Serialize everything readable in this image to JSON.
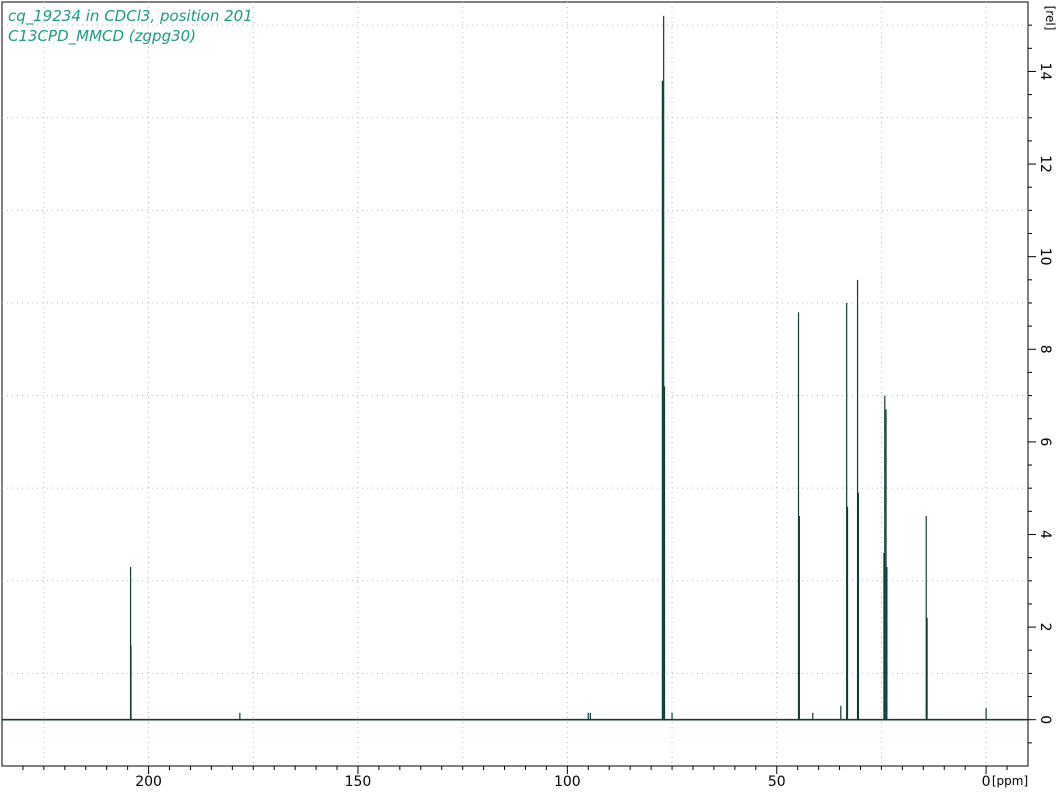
{
  "title_lines": [
    "cq_19234 in CDCl3, position 201",
    "C13CPD_MMCD (zgpg30)"
  ],
  "colors": {
    "spectrum": "#0d3b38",
    "title": "#1b9a86",
    "grid": "#b8b8b8",
    "frame": "#000000"
  },
  "chart_data": {
    "type": "line",
    "title": "cq_19234 in CDCl3, position 201",
    "subtitle": "C13CPD_MMCD (zgpg30)",
    "xlabel": "[ppm]",
    "ylabel": "[rel]",
    "xlim": [
      235,
      -10
    ],
    "ylim": [
      -1,
      15.5
    ],
    "x_reversed": true,
    "grid": true,
    "x_ticks": [
      200,
      150,
      100,
      50,
      0
    ],
    "x_tick_labels": [
      "200",
      "150",
      "100",
      "50",
      "0"
    ],
    "y_ticks": [
      0,
      2,
      4,
      6,
      8,
      10,
      12,
      14
    ],
    "y_tick_labels": [
      "0",
      "2",
      "4",
      "6",
      "8",
      "10",
      "12",
      "14"
    ],
    "peaks": [
      {
        "ppm": 204.3,
        "intensity": 3.3
      },
      {
        "ppm": 204.2,
        "intensity": 1.6
      },
      {
        "ppm": 178.2,
        "intensity": 0.15
      },
      {
        "ppm": 95.0,
        "intensity": 0.15
      },
      {
        "ppm": 94.5,
        "intensity": 0.15
      },
      {
        "ppm": 77.3,
        "intensity": 13.8
      },
      {
        "ppm": 77.0,
        "intensity": 15.2
      },
      {
        "ppm": 76.8,
        "intensity": 7.2
      },
      {
        "ppm": 75.0,
        "intensity": 0.15
      },
      {
        "ppm": 44.8,
        "intensity": 8.8
      },
      {
        "ppm": 44.6,
        "intensity": 4.4
      },
      {
        "ppm": 41.4,
        "intensity": 0.15
      },
      {
        "ppm": 34.7,
        "intensity": 0.3
      },
      {
        "ppm": 33.3,
        "intensity": 9.0
      },
      {
        "ppm": 33.1,
        "intensity": 4.6
      },
      {
        "ppm": 30.7,
        "intensity": 9.5
      },
      {
        "ppm": 30.5,
        "intensity": 4.9
      },
      {
        "ppm": 24.2,
        "intensity": 7.0
      },
      {
        "ppm": 23.9,
        "intensity": 6.7
      },
      {
        "ppm": 24.4,
        "intensity": 3.6
      },
      {
        "ppm": 23.7,
        "intensity": 3.3
      },
      {
        "ppm": 14.3,
        "intensity": 4.4
      },
      {
        "ppm": 14.1,
        "intensity": 2.2
      },
      {
        "ppm": 0.0,
        "intensity": 0.25
      }
    ]
  }
}
